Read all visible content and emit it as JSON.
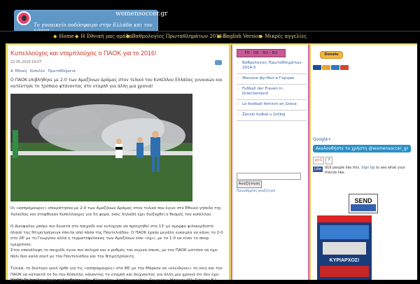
{
  "header": {
    "site_name": "womensoccer.gr",
    "tagline": "Το γυναικείο ποδόσφαιρο στην Ελλάδα και τον κόσμο"
  },
  "nav": {
    "items": [
      {
        "label": "Home"
      },
      {
        "label": "Η Εθνική μας ομάδα"
      },
      {
        "label": "Βαθμολογίες Πρωταθλημάτων 2014-5"
      },
      {
        "label": "English Version"
      },
      {
        "label": "Μικρές αγγελίες"
      }
    ]
  },
  "post": {
    "title": "Κυπελλούχος και νταμπλούχος ο ΠΑΟΚ για το 2016!",
    "date": "22.05.2016",
    "time": "19:07",
    "categories": [
      "Α. Εθνική",
      "Κύπελλο",
      "Πρωταθλήματα"
    ],
    "excerpt": "Ο ΠΑΟΚ επιβλήθηκε με 2-0 των Αμαζόνων Δράμας στον τελικό του Κυπέλλου Ελλάδας γυναικών και κατέκτησε το τρόπαιο φτάνοντας στο νταμπλ για άλλη μια χρονιά!",
    "paragraphs": [
      "Οι «ασπρόμαυρες» επικράτησαν με 2-0 των Αμαζόνων Δράμας στον τελικό που έγινε στο Εθνικό γήπεδο της Χαλκίδας και στέφθηκαν Κυπελλούχες για 5η φορά, όσες δηλαδή έχει διεξαχθεί ο θεσμός του κυπέλλου.",
      "Ο Δικέφαλος μπήκε πιο δυνατά στο παιχνίδι και ευτύχησε να προηγηθεί στο 13' με όμορφο φιλοκερδιστό πλασέ της Ντιμητράγκιγκ έπειτα από πάσα της Παντελιάδου. Ο ΠΑΟΚ έχασε μεγάλη ευκαιρία να κάνει το 2-0 στο 28' με τη Γεωργίου αλλά η τερματοφύλακας των Αμαζόνων είπε «όχι», με το 1-0 να είναι το σκορ ημιχρόνου.",
      "Στην επανάληψη το παιχνίδι έγινε πιο σκληρό και ο ρυθμός του αγώνα έπεσε, με τον ΠΑΟΚ ωστόσο να έχει πάλι δύο καλά σουτ με την Παντελιάδου και την Ντιμητρόγκιτς.",
      "Τελικά, το δεύτερο γκολ ήρθε για τις «ασπρόμαυρες» στο 86' με την Μάρκου να «κλειδώνει» τη νίκη και τον ΠΑΟΚ να κατακτά το 5ο του Κύπελλο, κάνοντας το νταμπλ και δείχνοντας για άλλη μια χρονιά ότι δεν έχει αντίπαλο στο γυναικείο ποδόσφαιρο.",
      "ΠΑΟΚ: Πελετίδου, Δημητρίου, Πελεκούδα, Βλασιάδου, Χατζηγιαννίδου, Γεωργίου, Μάρκου (91' Γιάννου Ε.),"
    ]
  },
  "sidebar": {
    "languages": "FR - DE - RU - BU",
    "links": [
      {
        "label": "Βαθμολογίες Πρωταθλημάτων 2014-5"
      },
      {
        "label": "Женски футбол в Гърция"
      },
      {
        "label": "Fußball der Frauen in Griechenland"
      },
      {
        "label": "Le football féminin en Grèce"
      },
      {
        "label": "Ženski fudbal u Grčkoj"
      }
    ],
    "search_button": "Αναζήτηση",
    "ad_text": "Προωθημένη αναζήτηση"
  },
  "right": {
    "donate_label": "Donate",
    "google_plus": "Google+",
    "twitter_follow": "Ακολουθήστε το χρήστη @womensoccer_gr",
    "gplus_button": "g+1",
    "gplus_count": "?",
    "fb_like": "Like",
    "fb_count": "916 people like this.",
    "fb_signup": "Sign Up",
    "fb_rest": "to see what your friends like.",
    "send_logo": "SEND",
    "magazine_title": "ΚΥΡΙΑΡΧΟΣ!"
  },
  "colors": {
    "accent_red": "#c8392e",
    "link_blue": "#2c5ca8",
    "frame_yellow": "#e1d25a",
    "sidebar_pink": "#d468a6",
    "header_blue": "#5f97c6"
  }
}
